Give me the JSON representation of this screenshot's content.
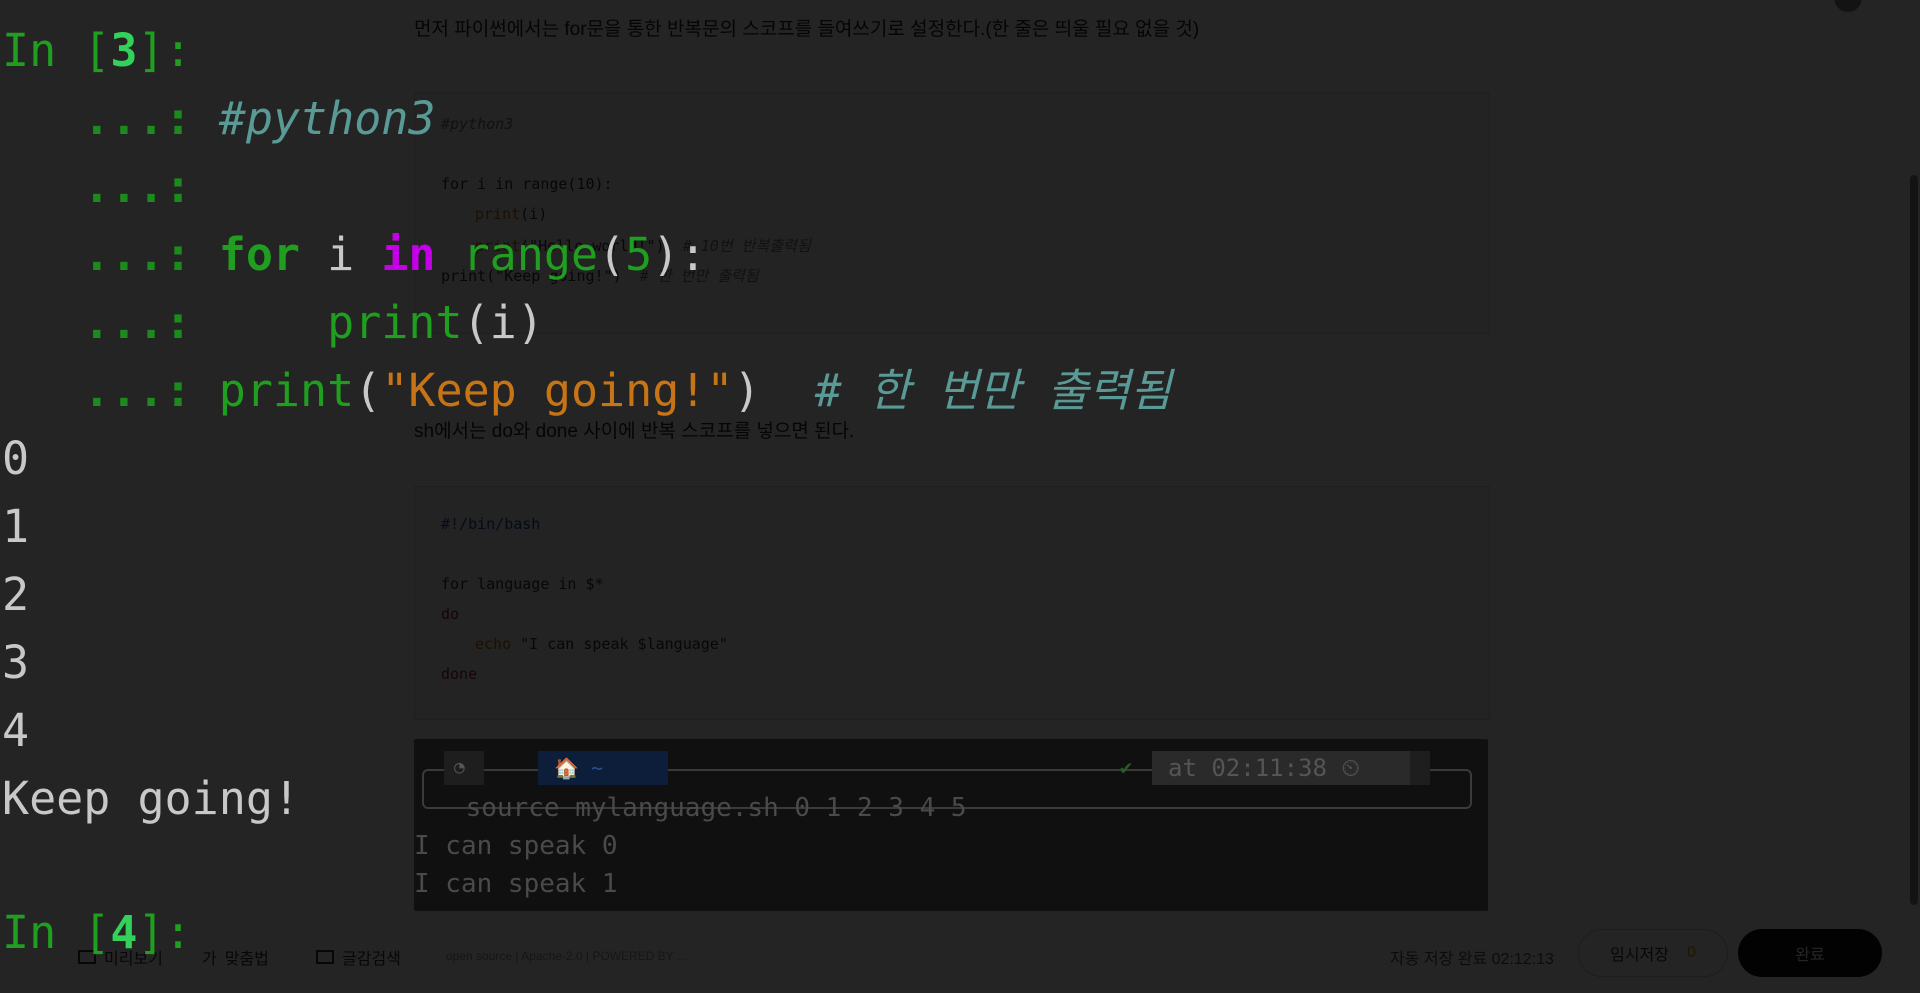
{
  "editor": {
    "intro_text": "먼저 파이썬에서는 for문을 통한 반복문의 스코프를 들여쓰기로 설정한다.(한 줄은 띄울 필요 없을 것)",
    "python_block": {
      "line1": "#python3",
      "line2": "for i in range(10):",
      "line3_fn": "print",
      "line3_rest": "(i)",
      "line4_fn": "print",
      "line4_str": "(\"Hello world!\")",
      "line4_cm": "# 10번 반복출력됨",
      "line5": "print(\"Keep going!\")",
      "line5_cm": "# 한 번만 출력됨"
    },
    "sh_text": "sh에서는 do와 done 사이에 반복 스코프를 넣으면 된다.",
    "bash_block": {
      "line1": "#!/bin/bash",
      "line2": "for language in $*",
      "line3": "do",
      "line4_fn": "echo",
      "line4_str": " \"I can speak $language\"",
      "line5": "done"
    }
  },
  "terminal": {
    "ubuntu_icon": "ubuntu-logo-icon",
    "home_segment": "🏠 ~",
    "check": "✔",
    "time_label": "at 02:11:38 ⏲",
    "command": " source mylanguage.sh 0 1 2 3 4 5",
    "output1": "I can speak 0",
    "output2": "I can speak 1"
  },
  "footer": {
    "preview": "미리보기",
    "spellcheck": "맞춤법",
    "font_search": "글감검색",
    "license": "open source | Apache-2.0 | POWERED BY ...",
    "autosave": "자동 저장 완료 02:12:13",
    "draft_label": "임시저장",
    "draft_count": "0",
    "done_label": "완료"
  },
  "ipython": {
    "in3_prefix": "In [",
    "in3_num": "3",
    "in3_suffix": "]:",
    "cont": "   ...: ",
    "comment": "#python3",
    "for_kw": "for",
    "var_i": " i ",
    "in_kw": "in",
    "range_fn": " range",
    "paren_open": "(",
    "five": "5",
    "paren_close_colon": "):",
    "indent": "    ",
    "print_fn": "print",
    "print_arg": "(i)",
    "keep_str": "\"Keep going!\"",
    "close_paren": ")",
    "inline_comment": "  # 한 번만 출력됨",
    "outputs": [
      "0",
      "1",
      "2",
      "3",
      "4"
    ],
    "keep_output": "Keep going!",
    "in4_prefix": "In [",
    "in4_num": "4",
    "in4_suffix": "]:"
  }
}
